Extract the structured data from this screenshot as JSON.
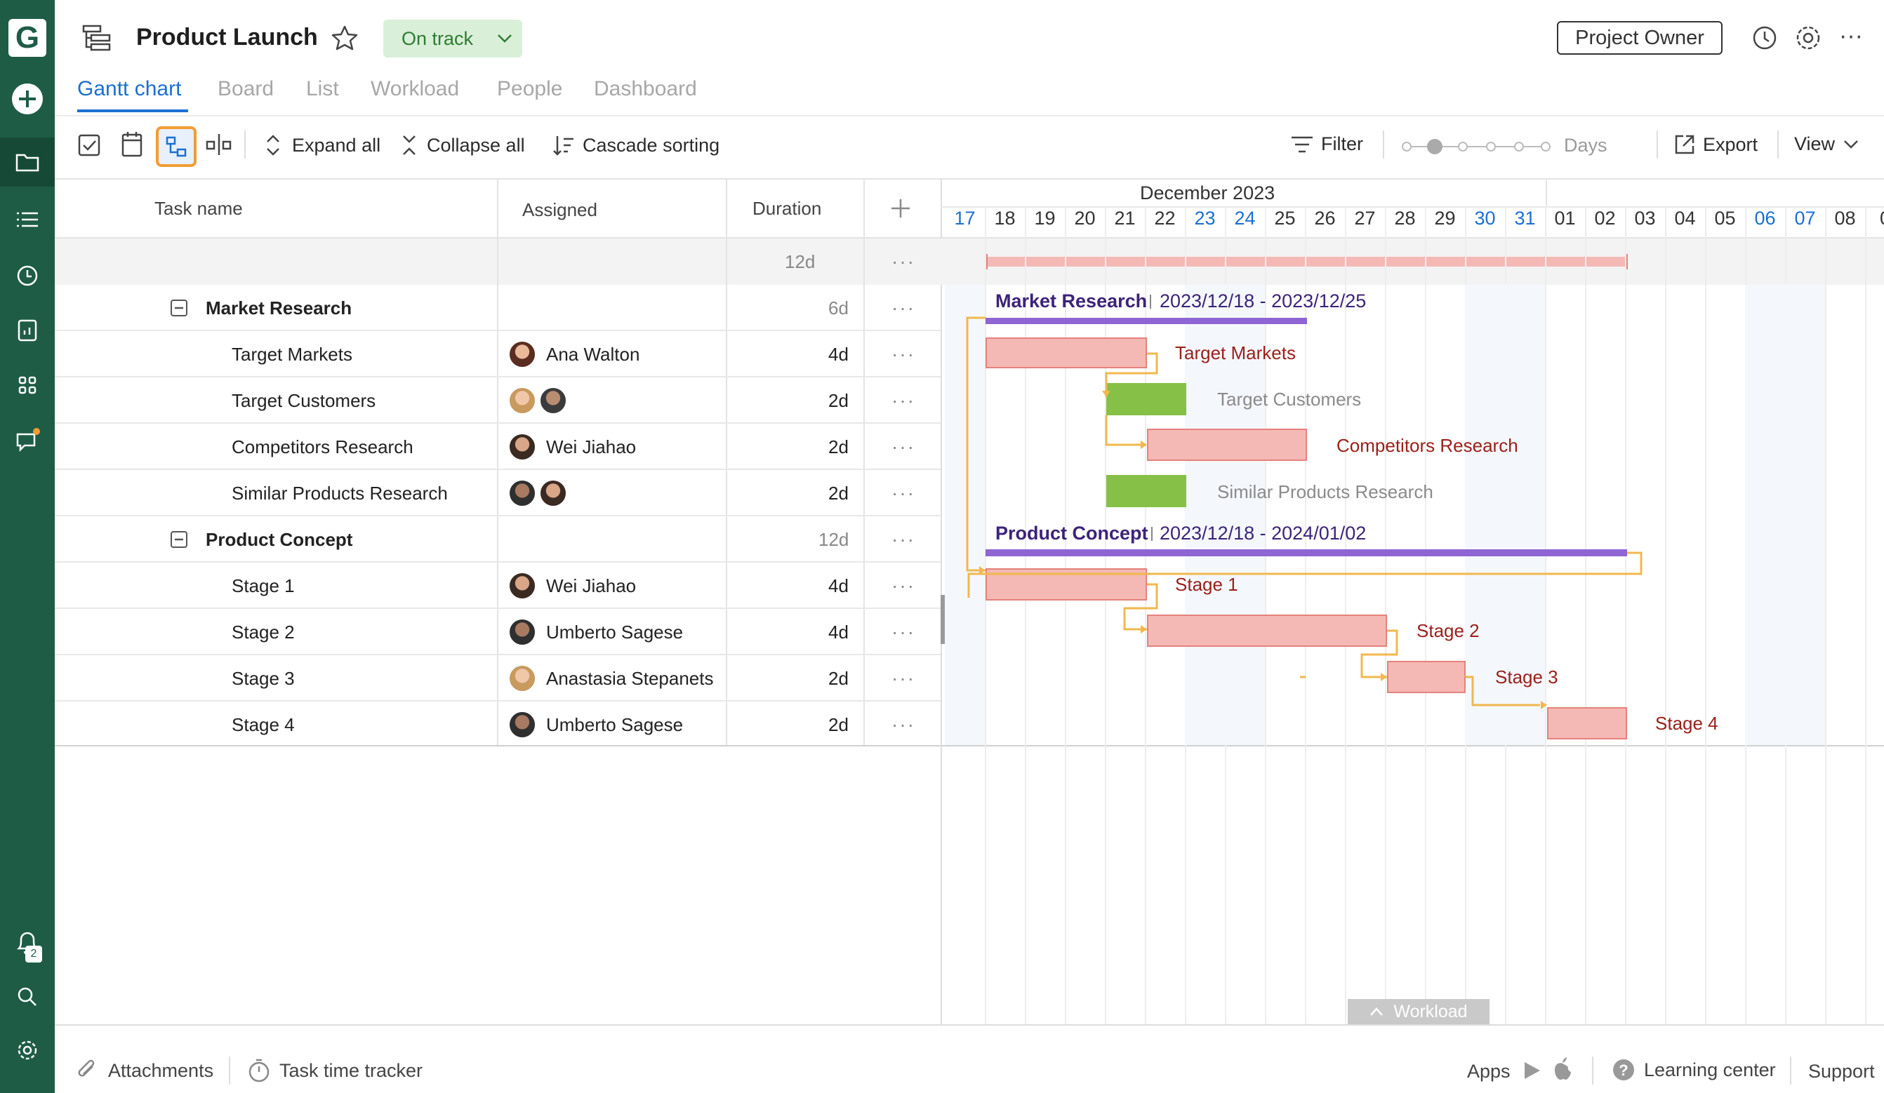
{
  "app": {
    "logo": "G",
    "project_title": "Product Launch",
    "status": "On track",
    "role_button": "Project Owner",
    "accent": "#1c6fd1",
    "rail_color": "#1e5c46",
    "notification_count": "2"
  },
  "tabs": [
    {
      "label": "Gantt chart",
      "active": true
    },
    {
      "label": "Board"
    },
    {
      "label": "List"
    },
    {
      "label": "Workload"
    },
    {
      "label": "People"
    },
    {
      "label": "Dashboard"
    }
  ],
  "toolbar": {
    "expand_all": "Expand all",
    "collapse_all": "Collapse all",
    "cascade_sorting": "Cascade sorting",
    "filter": "Filter",
    "zoom_label": "Days",
    "export": "Export",
    "view": "View"
  },
  "grid": {
    "columns": {
      "task": "Task name",
      "assigned": "Assigned",
      "duration": "Duration"
    },
    "summary_duration": "12d",
    "rows": [
      {
        "type": "group",
        "name": "Market Research",
        "assigned": "",
        "duration": "6d"
      },
      {
        "type": "task",
        "name": "Target Markets",
        "assigned": "Ana Walton",
        "duration": "4d"
      },
      {
        "type": "task",
        "name": "Target Customers",
        "assigned": "",
        "duration": "2d"
      },
      {
        "type": "task",
        "name": "Competitors Research",
        "assigned": "Wei Jiahao",
        "duration": "2d"
      },
      {
        "type": "task",
        "name": "Similar Products Research",
        "assigned": "",
        "duration": "2d"
      },
      {
        "type": "group",
        "name": "Product Concept",
        "assigned": "",
        "duration": "12d"
      },
      {
        "type": "task",
        "name": "Stage 1",
        "assigned": "Wei Jiahao",
        "duration": "4d"
      },
      {
        "type": "task",
        "name": "Stage 2",
        "assigned": "Umberto Sagese",
        "duration": "4d"
      },
      {
        "type": "task",
        "name": "Stage 3",
        "assigned": "Anastasia Stepanets",
        "duration": "2d"
      },
      {
        "type": "task",
        "name": "Stage 4",
        "assigned": "Umberto Sagese",
        "duration": "2d"
      }
    ]
  },
  "timeline": {
    "month": "December 2023",
    "days": [
      "17",
      "18",
      "19",
      "20",
      "21",
      "22",
      "23",
      "24",
      "25",
      "26",
      "27",
      "28",
      "29",
      "30",
      "31",
      "01",
      "02",
      "03",
      "04",
      "05",
      "06",
      "07",
      "08",
      "0"
    ],
    "weekend_days": [
      "17",
      "23",
      "24",
      "30",
      "31",
      "06",
      "07"
    ]
  },
  "gantt": {
    "market_research_label": "Market Research",
    "market_research_dates": "2023/12/18 - 2023/12/25",
    "product_concept_label": "Product Concept",
    "product_concept_dates": "2023/12/18 - 2024/01/02",
    "bars": [
      {
        "label": "Target Markets",
        "color": "pink"
      },
      {
        "label": "Target Customers",
        "color": "green"
      },
      {
        "label": "Competitors Research",
        "color": "pink"
      },
      {
        "label": "Similar Products Research",
        "color": "green"
      },
      {
        "label": "Stage 1",
        "color": "pink"
      },
      {
        "label": "Stage 2",
        "color": "pink"
      },
      {
        "label": "Stage 3",
        "color": "pink"
      },
      {
        "label": "Stage 4",
        "color": "pink"
      }
    ],
    "workload_toggle": "Workload"
  },
  "footer": {
    "attachments": "Attachments",
    "time_tracker": "Task time tracker",
    "apps": "Apps",
    "learning_center": "Learning center",
    "support": "Support"
  }
}
